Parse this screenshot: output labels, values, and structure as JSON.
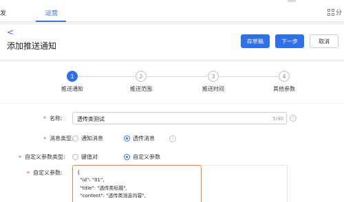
{
  "topnav": {
    "left_label": "发",
    "active_tab": "运营",
    "right_label": "分"
  },
  "header": {
    "back": "<",
    "title": "添加推送通知",
    "buttons": {
      "draft": "存草稿",
      "next": "下一步",
      "cancel": "取消"
    }
  },
  "steps": [
    {
      "num": "1",
      "label": "推送通知"
    },
    {
      "num": "2",
      "label": "推送范围"
    },
    {
      "num": "3",
      "label": "推送时间"
    },
    {
      "num": "4",
      "label": "其他参数"
    }
  ],
  "form": {
    "required_mark": "*",
    "name": {
      "label": "名称:",
      "value": "透传类测试",
      "count": "5/40"
    },
    "msg_type": {
      "label": "消息类型:",
      "options": [
        "通知消息",
        "透传消息"
      ],
      "selected": "透传消息"
    },
    "param_type": {
      "label": "自定义参数类型:",
      "options": [
        "键值对",
        "自定义参数"
      ],
      "selected": "自定义参数"
    },
    "custom_params": {
      "label": "自定义参数:",
      "lines": [
        "{",
        "  \"id\": \"01\",",
        "  \"title\": \"透传类标题\",",
        "  \"content\": \"透传类消息内容\","
      ]
    },
    "help": "?"
  },
  "colors": {
    "accent": "#2f6fe8",
    "required": "#e5383b",
    "focus_border": "#e9833a"
  }
}
